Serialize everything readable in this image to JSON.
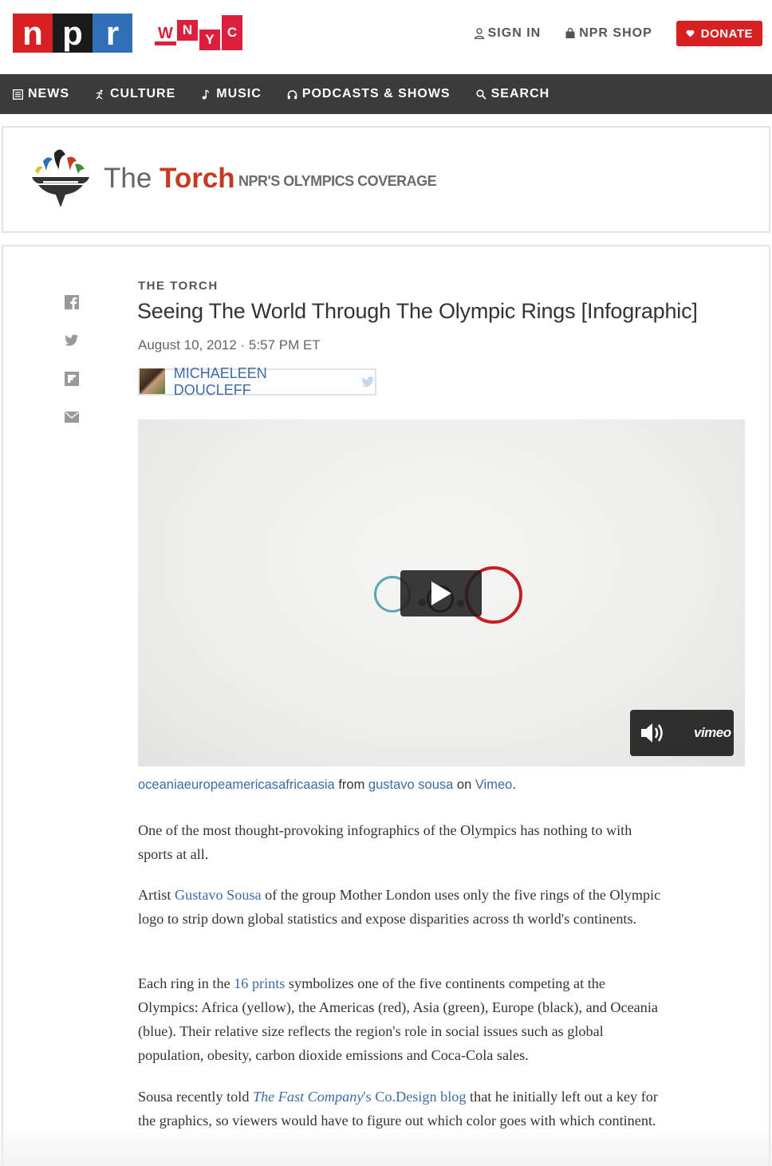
{
  "header": {
    "npr_logo": [
      "n",
      "p",
      "r"
    ],
    "wnyc_logo": [
      "W",
      "N",
      "Y",
      "C"
    ],
    "sign_in": "SIGN IN",
    "shop": "NPR SHOP",
    "donate": "DONATE",
    "donate_icon": "heart-icon"
  },
  "nav": {
    "items": [
      {
        "label": "NEWS",
        "icon": "news-icon"
      },
      {
        "label": "CULTURE",
        "icon": "culture-icon"
      },
      {
        "label": "MUSIC",
        "icon": "music-icon"
      },
      {
        "label": "PODCASTS & SHOWS",
        "icon": "headphones-icon"
      },
      {
        "label": "SEARCH",
        "icon": "search-icon"
      }
    ]
  },
  "banner": {
    "title_prefix": "The",
    "title_name": "Torch",
    "subtitle": "NPR'S OLYMPICS COVERAGE"
  },
  "article": {
    "slug": "THE TORCH",
    "headline": "Seeing The World Through The Olympic Rings [Infographic]",
    "date": "August 10, 2012 · 5:57 PM ET",
    "author": "MICHAELEEN DOUCLEFF",
    "share": [
      "facebook-icon",
      "twitter-icon",
      "flipboard-icon",
      "email-icon"
    ],
    "video": {
      "brand": "vimeo",
      "caption_link1": "oceaniaeuropeamericasafricaasia",
      "caption_from": " from ",
      "caption_link2": "gustavo sousa",
      "caption_on": " on ",
      "caption_link3": "Vimeo",
      "caption_end": "."
    },
    "p1": "One of the most thought-provoking infographics of the Olympics has nothing to with sports at all.",
    "p2_a": "Artist ",
    "p2_link": "Gustavo Sousa",
    "p2_b": " of the group Mother London uses only the five rings of the Olympic logo to strip down global statistics and expose disparities across th world's continents.",
    "p3_a": "Each ring in the ",
    "p3_link": "16 prints",
    "p3_b": " symbolizes one of the five continents competing at the Olympics: Africa (yellow), the Americas (red), Asia (green), Europe (black), and Oceania (blue). Their relative size reflects the region's role in social issues such as global population, obesity, carbon dioxide emissions and Coca-Cola sales.",
    "p4_a": "Sousa recently told ",
    "p4_link_italic": "The Fast Company",
    "p4_link_rest": "'s Co.Design blog",
    "p4_b": " that he initially left out a key for the graphics, so viewers would have to figure out which color goes with which continent."
  }
}
